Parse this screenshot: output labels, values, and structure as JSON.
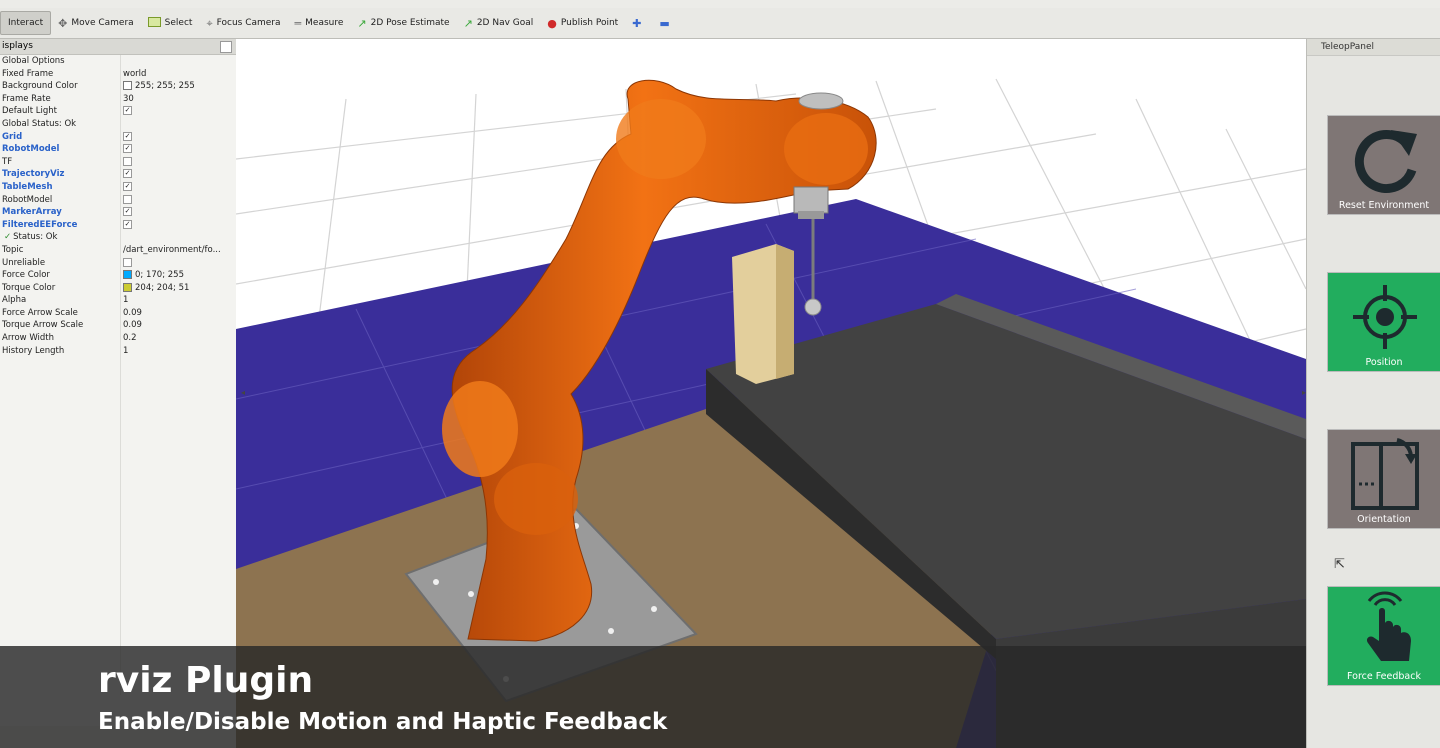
{
  "toolbar": {
    "items": [
      {
        "label": "Interact",
        "icon": "interact-icon"
      },
      {
        "label": "Move Camera",
        "icon": "move-camera-icon"
      },
      {
        "label": "Select",
        "icon": "select-icon"
      },
      {
        "label": "Focus Camera",
        "icon": "focus-camera-icon"
      },
      {
        "label": "Measure",
        "icon": "measure-icon"
      },
      {
        "label": "2D Pose Estimate",
        "icon": "pose-estimate-icon"
      },
      {
        "label": "2D Nav Goal",
        "icon": "nav-goal-icon"
      },
      {
        "label": "Publish Point",
        "icon": "publish-point-icon"
      }
    ]
  },
  "displays": {
    "title": "isplays",
    "rows": {
      "global_options": "Global Options",
      "fixed_frame": {
        "label": "Fixed Frame",
        "value": "world"
      },
      "background_color": {
        "label": "Background Color",
        "value": "255; 255; 255"
      },
      "frame_rate": {
        "label": "Frame Rate",
        "value": "30"
      },
      "default_light": {
        "label": "Default Light",
        "value": "✓"
      },
      "global_status": "Global Status: Ok",
      "grid": {
        "label": "Grid",
        "value": "✓"
      },
      "robot_model": {
        "label": "RobotModel",
        "value": "✓"
      },
      "tf": {
        "label": "TF",
        "value": ""
      },
      "trajectory_viz": {
        "label": "TrajectoryViz",
        "value": "✓"
      },
      "table_mesh": {
        "label": "TableMesh",
        "value": "✓"
      },
      "robot_model_2": {
        "label": "RobotModel",
        "value": ""
      },
      "marker_array": {
        "label": "MarkerArray",
        "value": "✓"
      },
      "filtered_ee_force": {
        "label": "FilteredEEForce",
        "value": "✓"
      },
      "status": "Status: Ok",
      "topic": {
        "label": "Topic",
        "value": "/dart_environment/fo..."
      },
      "unreliable": {
        "label": "Unreliable",
        "value": ""
      },
      "force_color": {
        "label": "Force Color",
        "value": "0; 170; 255"
      },
      "torque_color": {
        "label": "Torque Color",
        "value": "204; 204; 51"
      },
      "alpha": {
        "label": "Alpha",
        "value": "1"
      },
      "force_arrow_scale": {
        "label": "Force Arrow Scale",
        "value": "0.09"
      },
      "torque_arrow_scale": {
        "label": "Torque Arrow Scale",
        "value": "0.09"
      },
      "arrow_width": {
        "label": "Arrow Width",
        "value": "0.2"
      },
      "history_length": {
        "label": "History Length",
        "value": "1"
      }
    }
  },
  "colors": {
    "force_color": "#00aaff",
    "torque_color": "#cccc33",
    "robot_orange": "#e8620e",
    "floor_blue": "#3a2e9a",
    "table_tan": "#8d7350",
    "button_green": "#22ad5e",
    "button_gray": "#7f7675"
  },
  "teleop": {
    "title": "TeleopPanel",
    "buttons": {
      "reset": "Reset Environment",
      "position": "Position",
      "orientation": "Orientation",
      "force": "Force Feedback"
    }
  },
  "caption": {
    "title": "rviz Plugin",
    "subtitle": "Enable/Disable Motion and Haptic Feedback"
  }
}
